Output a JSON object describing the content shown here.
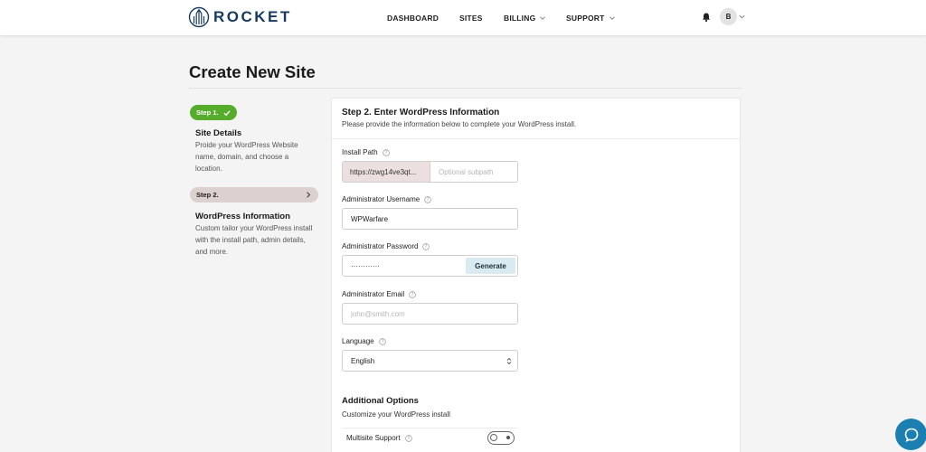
{
  "brand": {
    "name": "ROCKET",
    "color": "#163a5f"
  },
  "nav": {
    "dashboard": "DASHBOARD",
    "sites": "SITES",
    "billing": "BILLING",
    "support": "SUPPORT"
  },
  "user": {
    "initial": "B"
  },
  "page": {
    "title": "Create New Site"
  },
  "steps": {
    "step1": {
      "badge": "Step 1.",
      "title": "Site Details",
      "description": "Proide your WordPress Website name, domain, and choose a location.",
      "color": "#55ad2b"
    },
    "step2": {
      "badge": "Step 2.",
      "title": "WordPress Information",
      "description": "Custom tailor your WordPress install with the install path, admin details, and more."
    }
  },
  "form": {
    "title": "Step 2. Enter WordPress Information",
    "subtitle": "Please provide the information below to complete your WordPress install.",
    "install_path": {
      "label": "Install Path",
      "prefix": "https://zwg14ve3qt...",
      "placeholder": "Optional subpath"
    },
    "admin_username": {
      "label": "Administrator Username",
      "value": "WPWarfare"
    },
    "admin_password": {
      "label": "Administrator Password",
      "value": "············",
      "generate_label": "Generate"
    },
    "admin_email": {
      "label": "Administrator Email",
      "placeholder": "john@smith.com"
    },
    "language": {
      "label": "Language",
      "value": "English"
    },
    "additional": {
      "title": "Additional Options",
      "subtitle": "Customize your WordPress install",
      "multisite_label": "Multisite Support"
    }
  },
  "icons": {
    "logo": "rocket-logo-icon",
    "bell": "bell-icon",
    "help": "help-circle-icon",
    "chat": "chat-icon"
  },
  "colors": {
    "chat": "#1b7fb1",
    "generate": "#d9ebf1",
    "step2_pill": "#ddd0d0"
  }
}
